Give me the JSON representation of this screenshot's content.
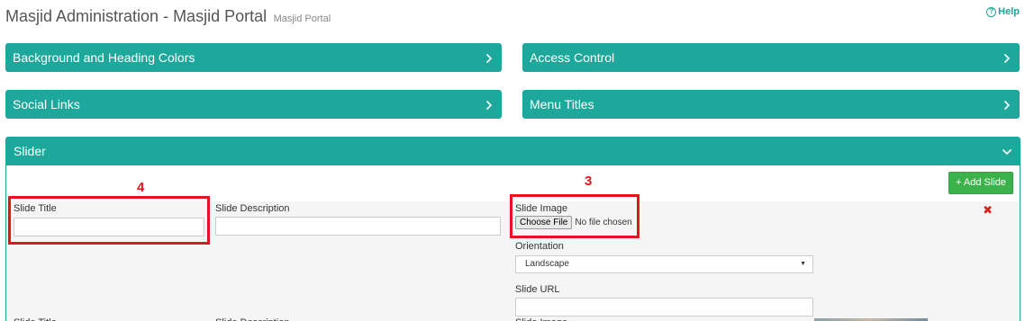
{
  "header": {
    "title": "Masjid Administration - Masjid Portal",
    "subtitle": "Masjid Portal",
    "help_label": "Help"
  },
  "panels": {
    "background_colors": "Background and Heading Colors",
    "access_control": "Access Control",
    "social_links": "Social Links",
    "menu_titles": "Menu Titles",
    "slider": "Slider"
  },
  "slider": {
    "add_slide_label": "+ Add Slide",
    "slide_title_label": "Slide Title",
    "slide_title_value": "",
    "slide_description_label": "Slide Description",
    "slide_description_value": "",
    "slide_image_label": "Slide Image",
    "choose_file_label": "Choose File",
    "no_file_text": "No file chosen",
    "orientation_label": "Orientation",
    "orientation_value": "Landscape",
    "slide_url_label": "Slide URL",
    "slide_url_value": "",
    "remove_icon": "close-icon"
  },
  "annotations": {
    "box_4_number": "4",
    "box_3_number": "3"
  },
  "colors": {
    "panel_teal": "#1ea89b",
    "add_button_green": "#3cb34a",
    "annotation_red": "#e3141b",
    "remove_red": "#e02020"
  }
}
